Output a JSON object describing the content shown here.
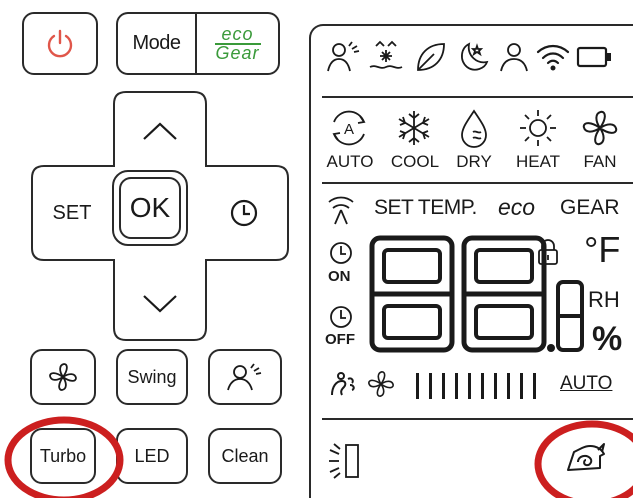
{
  "remote": {
    "mode_label": "Mode",
    "eco_gear_top": "eco",
    "eco_gear_bottom": "Gear",
    "set_label": "SET",
    "ok_label": "OK",
    "swing_label": "Swing",
    "turbo_label": "Turbo",
    "led_label": "LED",
    "clean_label": "Clean",
    "power_color": "#e0564a",
    "eco_color": "#3a9a3a",
    "highlight_color": "#cc1f1f"
  },
  "display": {
    "modes": [
      "AUTO",
      "COOL",
      "DRY",
      "HEAT",
      "FAN"
    ],
    "mode_auto_icon_letter": "A",
    "set_temp": "SET TEMP.",
    "eco_text": "eco",
    "gear_text": "GEAR",
    "on_label": "ON",
    "off_label": "OFF",
    "unit_f": "°F",
    "rh_label": "RH",
    "percent_label": "%",
    "fan_auto_label": "AUTO",
    "fan_speed_bars": 10
  }
}
